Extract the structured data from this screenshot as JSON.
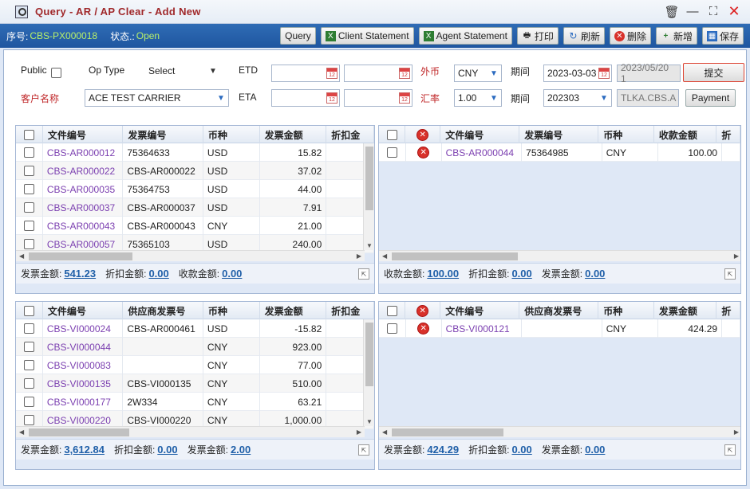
{
  "window": {
    "title": "Query - AR / AP Clear - Add New"
  },
  "infobar": {
    "seq_label": "序号:",
    "seq_value": "CBS-PX000018",
    "status_label": "状态.:",
    "status_value": "Open"
  },
  "toolbar": {
    "query": "Query",
    "client_statement": "Client Statement",
    "agent_statement": "Agent Statement",
    "print": "打印",
    "refresh": "刷新",
    "delete": "删除",
    "add": "新增",
    "save": "保存"
  },
  "form": {
    "public_label": "Public",
    "optype_label": "Op Type",
    "optype_value": "Select",
    "etd_label": "ETD",
    "currency_label": "外币",
    "currency_value": "CNY",
    "period_label": "期间",
    "period_date_value": "2023-03-03",
    "period_date_gray": "2023/05/20 1",
    "submit_label": "提交",
    "customer_label": "客户名称",
    "customer_value": "ACE TEST CARRIER",
    "eta_label": "ETA",
    "rate_label": "汇率",
    "rate_value": "1.00",
    "period2_label": "期间",
    "period2_value": "202303",
    "user_value": "TLKA.CBS.A",
    "payment_label": "Payment"
  },
  "grid_tl": {
    "headers": [
      "文件编号",
      "发票编号",
      "币种",
      "发票金额",
      "折扣金"
    ],
    "rows": [
      [
        "CBS-AR000012",
        "75364633",
        "USD",
        "15.82"
      ],
      [
        "CBS-AR000022",
        "CBS-AR000022",
        "USD",
        "37.02"
      ],
      [
        "CBS-AR000035",
        "75364753",
        "USD",
        "44.00"
      ],
      [
        "CBS-AR000037",
        "CBS-AR000037",
        "USD",
        "7.91"
      ],
      [
        "CBS-AR000043",
        "CBS-AR000043",
        "CNY",
        "21.00"
      ],
      [
        "CBS-AR000057",
        "75365103",
        "USD",
        "240.00"
      ]
    ],
    "footer": [
      {
        "label": "发票金额:",
        "value": "541.23"
      },
      {
        "label": "折扣金额:",
        "value": "0.00"
      },
      {
        "label": "收款金额:",
        "value": "0.00"
      }
    ]
  },
  "grid_tr": {
    "headers": [
      "文件编号",
      "发票编号",
      "币种",
      "收款金额",
      "折"
    ],
    "rows": [
      [
        "CBS-AR000044",
        "75364985",
        "CNY",
        "100.00"
      ]
    ],
    "footer": [
      {
        "label": "收款金额:",
        "value": "100.00"
      },
      {
        "label": "折扣金额:",
        "value": "0.00"
      },
      {
        "label": "发票金额:",
        "value": "0.00"
      }
    ]
  },
  "grid_bl": {
    "headers": [
      "文件编号",
      "供应商发票号",
      "币种",
      "发票金额",
      "折扣金"
    ],
    "rows": [
      [
        "CBS-VI000024",
        "CBS-AR000461",
        "USD",
        "-15.82"
      ],
      [
        "CBS-VI000044",
        "",
        "CNY",
        "923.00"
      ],
      [
        "CBS-VI000083",
        "",
        "CNY",
        "77.00"
      ],
      [
        "CBS-VI000135",
        "CBS-VI000135",
        "CNY",
        "510.00"
      ],
      [
        "CBS-VI000177",
        "2W334",
        "CNY",
        "63.21"
      ],
      [
        "CBS-VI000220",
        "CBS-VI000220",
        "CNY",
        "1,000.00"
      ]
    ],
    "footer": [
      {
        "label": "发票金额:",
        "value": "3,612.84"
      },
      {
        "label": "折扣金额:",
        "value": "0.00"
      },
      {
        "label": "发票金额:",
        "value": "2.00"
      }
    ]
  },
  "grid_br": {
    "headers": [
      "文件编号",
      "供应商发票号",
      "币种",
      "发票金额",
      "折"
    ],
    "rows": [
      [
        "CBS-VI000121",
        "",
        "CNY",
        "424.29"
      ]
    ],
    "footer": [
      {
        "label": "发票金额:",
        "value": "424.29"
      },
      {
        "label": "折扣金额:",
        "value": "0.00"
      },
      {
        "label": "发票金额:",
        "value": "0.00"
      }
    ]
  },
  "colors": {
    "title_red": "#a0282a",
    "header_blue": "#2f6cb5",
    "status_green": "#b8f06a",
    "link_purple": "#7b3fb0",
    "total_blue": "#1f5fa8"
  }
}
